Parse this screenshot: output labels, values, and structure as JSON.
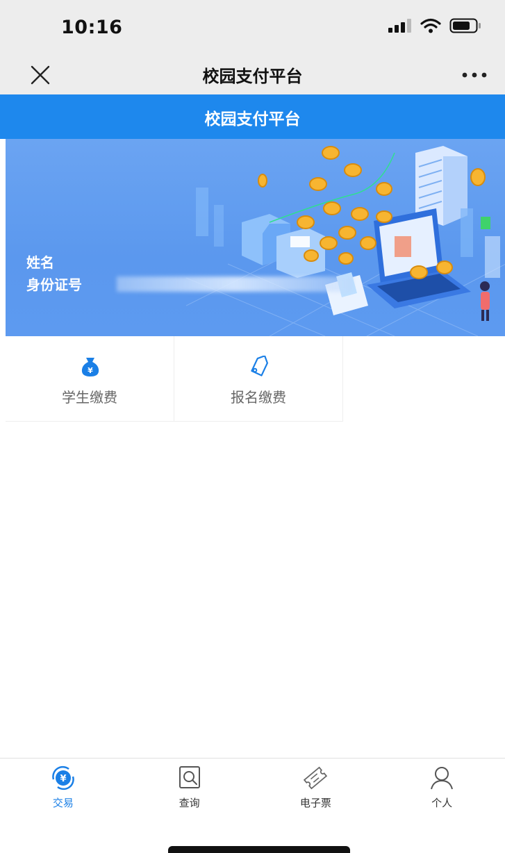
{
  "status_bar": {
    "time": "10:16"
  },
  "nav": {
    "title": "校园支付平台"
  },
  "header": {
    "title": "校园支付平台"
  },
  "banner": {
    "name_label": "姓名",
    "id_label": "身份证号"
  },
  "services": [
    {
      "label": "学生缴费",
      "icon": "money-bag-icon"
    },
    {
      "label": "报名缴费",
      "icon": "tag-icon"
    }
  ],
  "tabbar": {
    "tabs": [
      {
        "label": "交易",
        "icon": "yuan-cycle-icon",
        "active": true
      },
      {
        "label": "查询",
        "icon": "search-icon",
        "active": false
      },
      {
        "label": "电子票",
        "icon": "ticket-icon",
        "active": false
      },
      {
        "label": "个人",
        "icon": "person-icon",
        "active": false
      }
    ]
  },
  "colors": {
    "accent": "#1e88ed",
    "banner": "#5d9af0",
    "active_tab": "#1a7fe6"
  }
}
